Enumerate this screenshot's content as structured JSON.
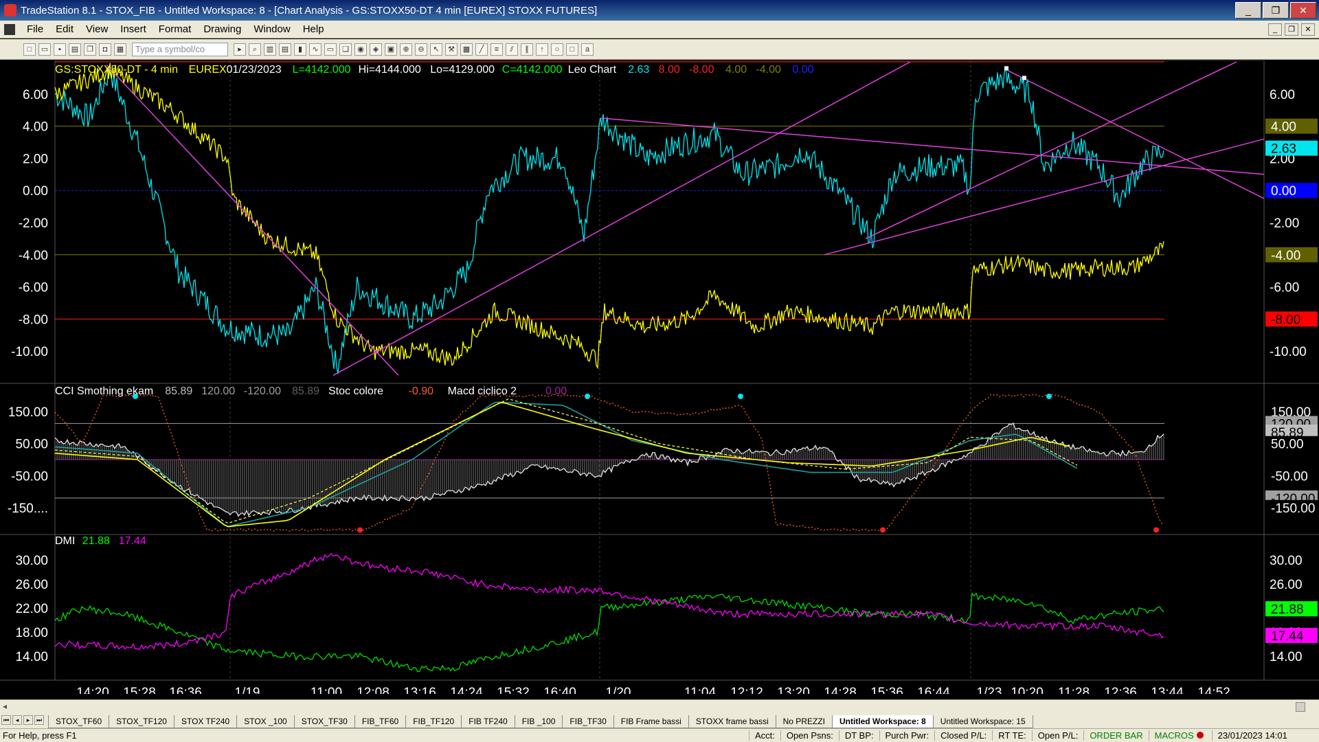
{
  "window": {
    "title": "TradeStation 8.1 - STOX_FIB - Untitled Workspace:  8 - [Chart Analysis - GS:STOXX50-DT  4 min  [EUREX] STOXX FUTURES]",
    "minimize": "_",
    "restore": "❐",
    "close": "✕"
  },
  "menu": {
    "items": [
      "File",
      "Edit",
      "View",
      "Insert",
      "Format",
      "Drawing",
      "Window",
      "Help"
    ]
  },
  "toolbar": {
    "symbol_placeholder": "Type a symbol/co"
  },
  "chart": {
    "header": {
      "symbol": "GS:STOXX50-DT - 4 min",
      "exchange": "EUREX",
      "date": "01/23/2023",
      "last": "L=4142.000",
      "high": "Hi=4144.000",
      "low": "Lo=4129.000",
      "close": "C=4142.000",
      "indicator": "Leo Chart",
      "vals": [
        "2.63",
        "8.00",
        "-8.00",
        "4.00",
        "-4.00",
        "0.00"
      ],
      "val_colors": [
        "#00e5ee",
        "#ff2020",
        "#ff2020",
        "#808000",
        "#808000",
        "#2020ff"
      ]
    },
    "panel1": {
      "ticks": [
        "6.00",
        "4.00",
        "2.00",
        "0.00",
        "-2.00",
        "-4.00",
        "-6.00",
        "-8.00",
        "-10.00"
      ],
      "tick_values": [
        6,
        4,
        2,
        0,
        -2,
        -4,
        -6,
        -8,
        -10
      ],
      "ylim": [
        -12,
        8
      ],
      "right_labels": [
        {
          "text": "4.00",
          "value": 4,
          "bg": "#606000",
          "fg": "#ffffff"
        },
        {
          "text": "2.63",
          "value": 2.63,
          "bg": "#00e5ee",
          "fg": "#000000"
        },
        {
          "text": "0.00",
          "value": 0,
          "bg": "#0000ff",
          "fg": "#ffffff"
        },
        {
          "text": "-4.00",
          "value": -4,
          "bg": "#606000",
          "fg": "#ffffff"
        },
        {
          "text": "-8.00",
          "value": -8,
          "bg": "#ff0000",
          "fg": "#000000"
        }
      ]
    },
    "panel2": {
      "title": "CCI Smothing ekam",
      "vals": [
        "85.89",
        "120.00",
        "-120.00",
        "85.89"
      ],
      "stoc_title": "Stoc colore",
      "stoc_val": "-0.90",
      "macd_title": "Macd ciclico 2",
      "macd_val": "0.00",
      "ticks": [
        "150.00",
        "50.00",
        "-50.00",
        "-150...."
      ],
      "tick_values": [
        150,
        50,
        -50,
        -150
      ],
      "ylim": [
        -230,
        230
      ],
      "right_labels": [
        {
          "text": "150.00",
          "value": 150,
          "bg": "#000000",
          "fg": "#ffffff"
        },
        {
          "text": "120.00",
          "value": 113,
          "bg": "#a0a0a0",
          "fg": "#000000"
        },
        {
          "text": "85.89",
          "value": 86,
          "bg": "#c0c0c0",
          "fg": "#000000"
        },
        {
          "text": "50.00",
          "value": 50,
          "bg": "#000000",
          "fg": "#ffffff"
        },
        {
          "text": "-50.00",
          "value": -50,
          "bg": "#000000",
          "fg": "#ffffff"
        },
        {
          "text": "-120.00",
          "value": -120,
          "bg": "#a0a0a0",
          "fg": "#000000"
        },
        {
          "text": "-150.00",
          "value": -150,
          "bg": "#000000",
          "fg": "#ffffff"
        }
      ]
    },
    "panel3": {
      "title": "DMI",
      "plus_val": "21.88",
      "minus_val": "17.44",
      "ticks": [
        "30.00",
        "26.00",
        "22.00",
        "18.00",
        "14.00"
      ],
      "tick_values": [
        30,
        26,
        22,
        18,
        14
      ],
      "ylim": [
        10,
        34
      ],
      "right_labels": [
        {
          "text": "21.88",
          "value": 21.88,
          "bg": "#00ff00",
          "fg": "#000000"
        },
        {
          "text": "17.44",
          "value": 17.44,
          "bg": "#ff00ff",
          "fg": "#000000"
        }
      ]
    },
    "time_labels": [
      "14:20",
      "15:28",
      "16:36",
      "1/19",
      "11:00",
      "12:08",
      "13:16",
      "14:24",
      "15:32",
      "16:40",
      "1/20",
      "11:04",
      "12:12",
      "13:20",
      "14:28",
      "15:36",
      "16:44",
      "1/23",
      "10:20",
      "11:28",
      "12:36",
      "13:44",
      "14:52"
    ]
  },
  "tabs": {
    "items": [
      "STOX_TF60",
      "STOX_TF120",
      "STOX TF240",
      "STOX _100",
      "STOX_TF30",
      "FIB_TF60",
      "FIB_TF120",
      "FIB TF240",
      "FIB _100",
      "FIB_TF30",
      "FIB Frame bassi",
      "STOXX frame bassi",
      "No PREZZI",
      "Untitled Workspace:  8",
      "Untitled Workspace:  15"
    ],
    "active_index": 13
  },
  "status": {
    "help": "For Help, press F1",
    "acct": "Acct:",
    "open_psns": "Open Psns:",
    "dt_bp": "DT BP:",
    "purch_pwr": "Purch Pwr:",
    "closed_pl": "Closed P/L:",
    "rt_te": "RT TE:",
    "open_pl": "Open P/L:",
    "order_bar": "ORDER BAR",
    "macros": "MACROS",
    "datetime": "23/01/2023 14:01"
  }
}
